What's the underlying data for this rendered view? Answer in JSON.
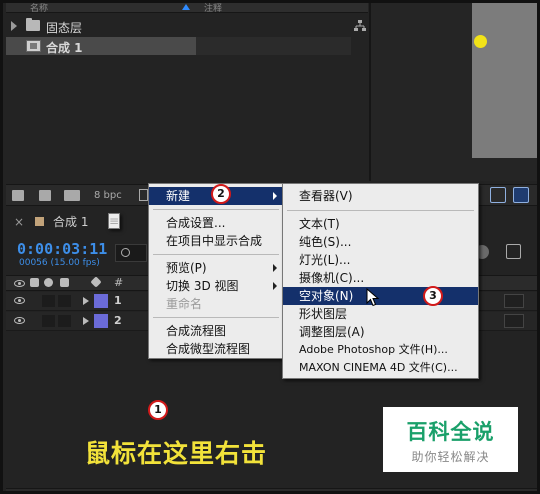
{
  "project_panel": {
    "columns": {
      "name": "名称",
      "comment": "注释"
    },
    "items": [
      {
        "label": "固态层",
        "type": "folder"
      },
      {
        "label": "合成 1",
        "type": "composition"
      }
    ]
  },
  "toolbar": {
    "bpc": "8 bpc"
  },
  "timeline": {
    "tab_name": "合成 1",
    "tab_menu": "≡",
    "timecode": "0:00:03:11",
    "frames": "00056 (15.00 fps)",
    "column_hash": "#",
    "layers": [
      {
        "num": "1"
      },
      {
        "num": "2"
      }
    ]
  },
  "context_menu": {
    "items": [
      {
        "label": "新建",
        "highlighted": true,
        "submenu": true
      },
      {
        "label": "合成设置..."
      },
      {
        "label": "在项目中显示合成"
      },
      {
        "label": "预览(P)",
        "submenu": true
      },
      {
        "label": "切换 3D 视图",
        "submenu": true
      },
      {
        "label": "重命名",
        "disabled": true
      },
      {
        "label": "合成流程图"
      },
      {
        "label": "合成微型流程图"
      }
    ]
  },
  "submenu": {
    "items": [
      {
        "label": "查看器(V)"
      },
      {
        "label": "文本(T)"
      },
      {
        "label": "纯色(S)..."
      },
      {
        "label": "灯光(L)..."
      },
      {
        "label": "摄像机(C)..."
      },
      {
        "label": "空对象(N)",
        "highlighted": true
      },
      {
        "label": "形状图层"
      },
      {
        "label": "调整图层(A)"
      },
      {
        "label": "Adobe Photoshop 文件(H)..."
      },
      {
        "label": "MAXON CINEMA 4D 文件(C)..."
      }
    ]
  },
  "annotations": {
    "step1": "1",
    "step2": "2",
    "step3": "3",
    "caption": "鼠标在这里右击"
  },
  "watermark": {
    "title": "百科全说",
    "subtitle": "助你轻松解决"
  },
  "colors": {
    "menu_highlight": "#14306b",
    "timecode_blue": "#3d8ee8",
    "caption_yellow": "#f2e23a",
    "layer_label": "#6b6bd8",
    "badge_red": "#d21a1a",
    "watermark_green": "#1aa06a",
    "null_dot": "#f2e318"
  }
}
